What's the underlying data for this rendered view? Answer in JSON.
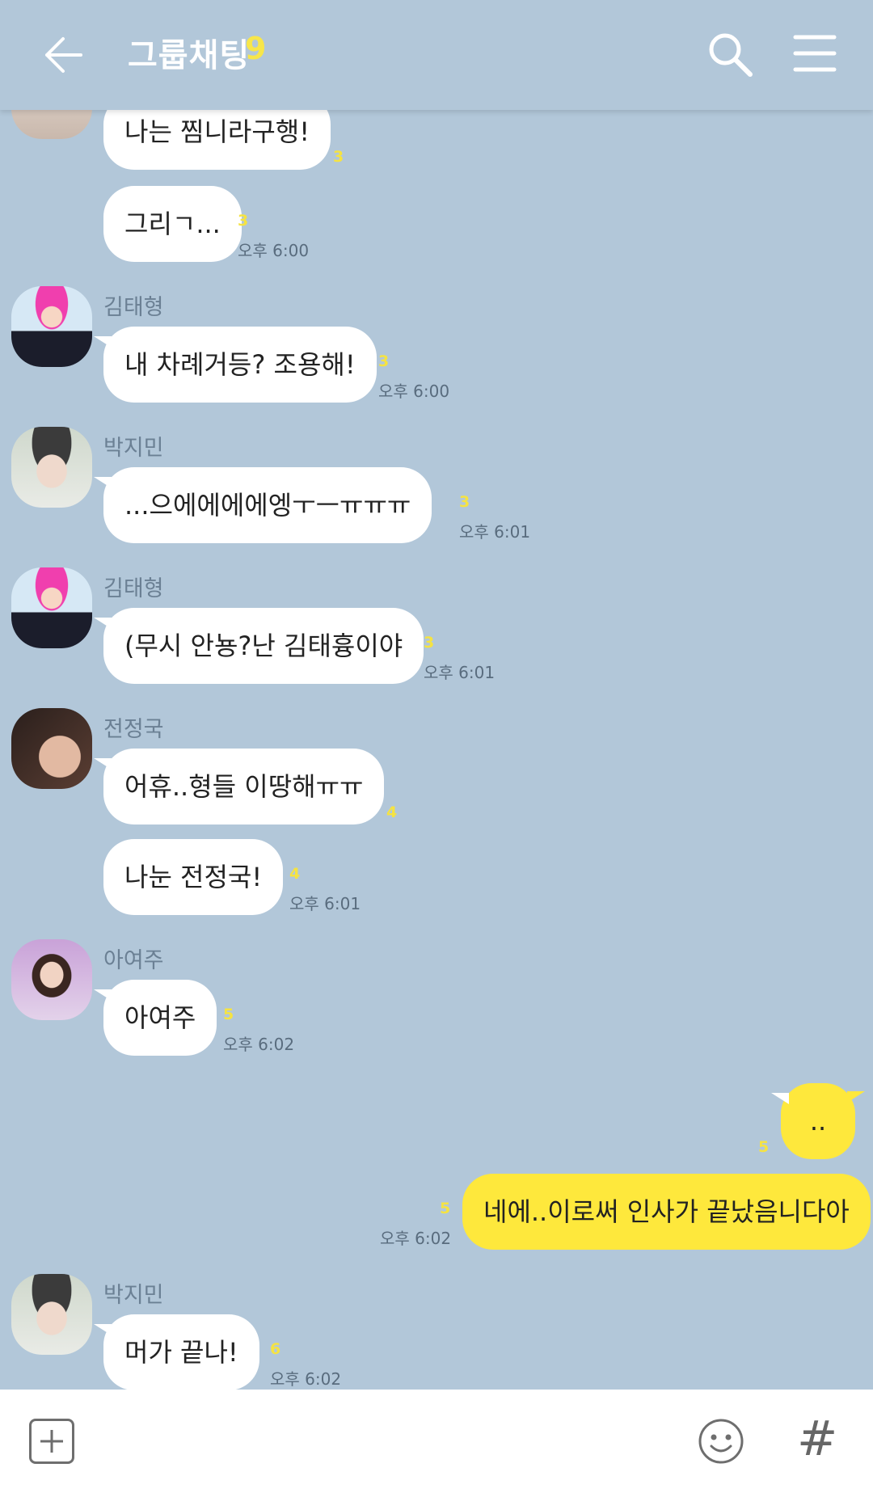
{
  "header": {
    "title": "그룹채팅",
    "member_count": "9"
  },
  "messages": [
    {
      "sender": "",
      "text": "나는 찜니라구행!",
      "unread": "3",
      "time": ""
    },
    {
      "sender": "",
      "text": "그리ㄱ...",
      "unread": "3",
      "time": "오후 6:00"
    },
    {
      "sender": "김태형",
      "text": "내 차례거등? 조용해!",
      "unread": "3",
      "time": "오후 6:00"
    },
    {
      "sender": "박지민",
      "text": "...으에에에에엥ㅜㅡㅠㅠㅠ",
      "unread": "3",
      "time": "오후 6:01"
    },
    {
      "sender": "김태형",
      "text": "(무시 안뇽?난 김태흉이야",
      "unread": "3",
      "time": "오후 6:01"
    },
    {
      "sender": "전정국",
      "text": "어휴..형들 이땅해ㅠㅠ",
      "unread": "4",
      "time": ""
    },
    {
      "sender": "",
      "text": "나눈 전정국!",
      "unread": "4",
      "time": "오후 6:01"
    },
    {
      "sender": "아여주",
      "text": "아여주",
      "unread": "5",
      "time": "오후 6:02"
    },
    {
      "sender": "",
      "text": "..",
      "unread": "5",
      "time": ""
    },
    {
      "sender": "",
      "text": "네에..이로써 인사가 끝났음니다아",
      "unread": "5",
      "time": "오후 6:02"
    },
    {
      "sender": "박지민",
      "text": "머가 끝나!",
      "unread": "6",
      "time": "오후 6:02"
    }
  ],
  "colors": {
    "background": "#b2c7d9",
    "my_bubble": "#fee83c",
    "other_bubble": "#ffffff",
    "unread": "#f5e342"
  },
  "icons": [
    "back-arrow-icon",
    "search-icon",
    "menu-icon",
    "plus-icon",
    "emoji-icon",
    "hash-icon"
  ]
}
